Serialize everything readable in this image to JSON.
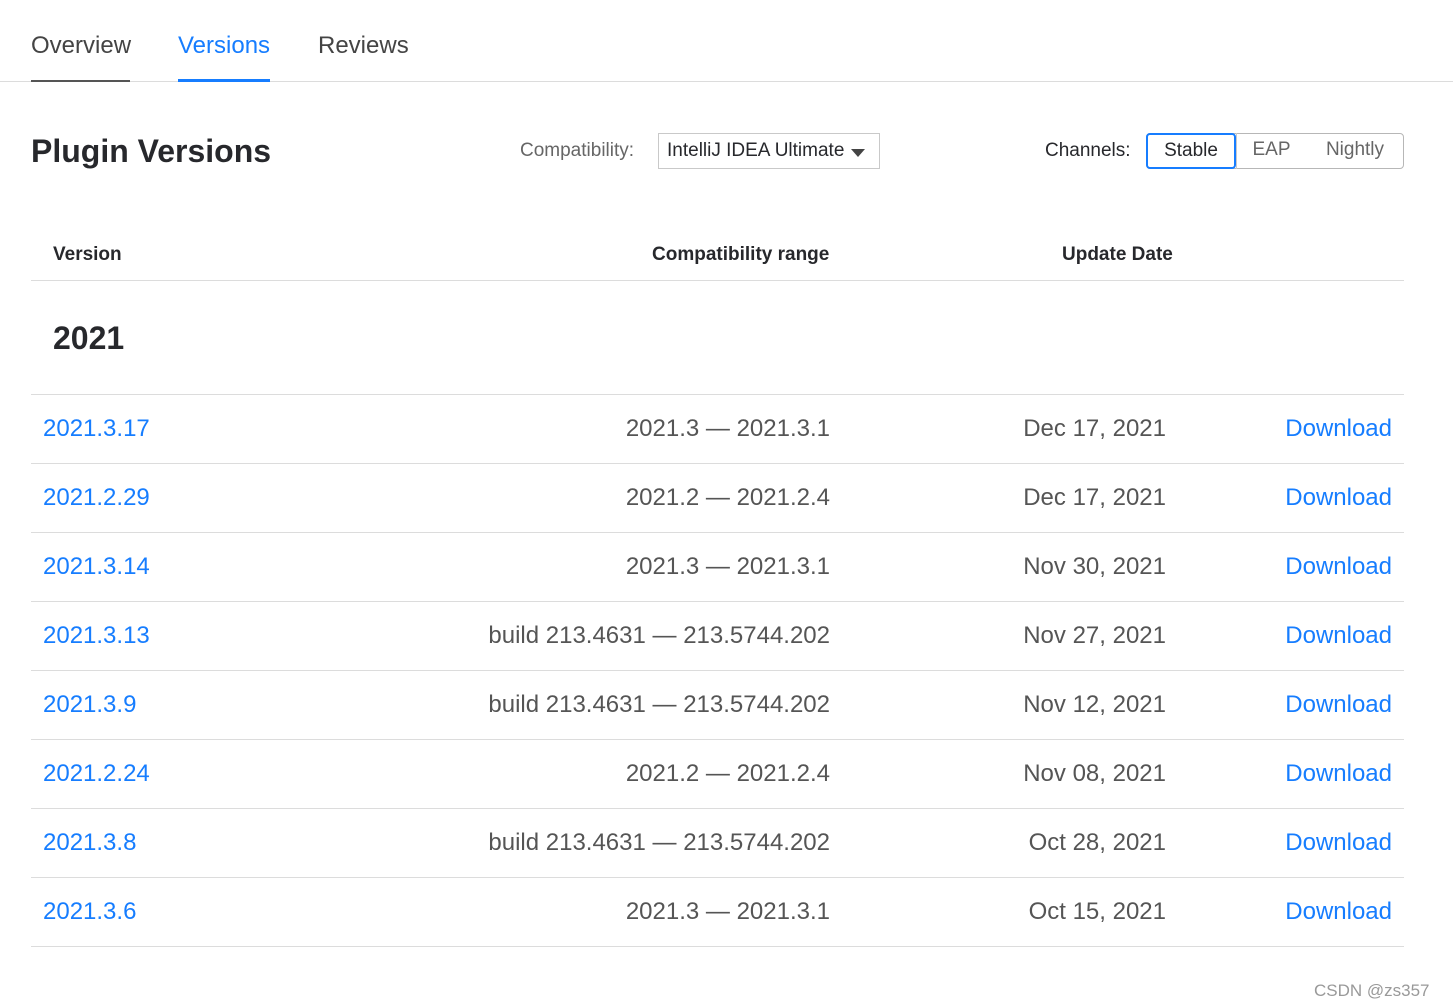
{
  "tabs": [
    {
      "label": "Overview"
    },
    {
      "label": "Versions"
    },
    {
      "label": "Reviews"
    }
  ],
  "header": {
    "title": "Plugin Versions",
    "compatibility_label": "Compatibility:",
    "compatibility_value": "IntelliJ IDEA Ultimate",
    "channels_label": "Channels:",
    "channels": [
      "Stable",
      "EAP",
      "Nightly"
    ],
    "selected_channel": "Stable"
  },
  "table": {
    "columns": [
      "Version",
      "Compatibility range",
      "Update Date"
    ],
    "group": "2021",
    "rows": [
      {
        "version": "2021.3.17",
        "range": "2021.3 — 2021.3.1",
        "date": "Dec 17, 2021",
        "action": "Download"
      },
      {
        "version": "2021.2.29",
        "range": "2021.2 — 2021.2.4",
        "date": "Dec 17, 2021",
        "action": "Download"
      },
      {
        "version": "2021.3.14",
        "range": "2021.3 — 2021.3.1",
        "date": "Nov 30, 2021",
        "action": "Download"
      },
      {
        "version": "2021.3.13",
        "range": "build 213.4631 — 213.5744.202",
        "date": "Nov 27, 2021",
        "action": "Download"
      },
      {
        "version": "2021.3.9",
        "range": "build 213.4631 — 213.5744.202",
        "date": "Nov 12, 2021",
        "action": "Download"
      },
      {
        "version": "2021.2.24",
        "range": "2021.2 — 2021.2.4",
        "date": "Nov 08, 2021",
        "action": "Download"
      },
      {
        "version": "2021.3.8",
        "range": "build 213.4631 — 213.5744.202",
        "date": "Oct 28, 2021",
        "action": "Download"
      },
      {
        "version": "2021.3.6",
        "range": "2021.3 — 2021.3.1",
        "date": "Oct 15, 2021",
        "action": "Download"
      }
    ]
  },
  "watermark": "CSDN @zs357",
  "colors": {
    "accent": "#167dff",
    "text": "#27282c",
    "muted": "#555555",
    "divider": "#dcdcdc"
  }
}
